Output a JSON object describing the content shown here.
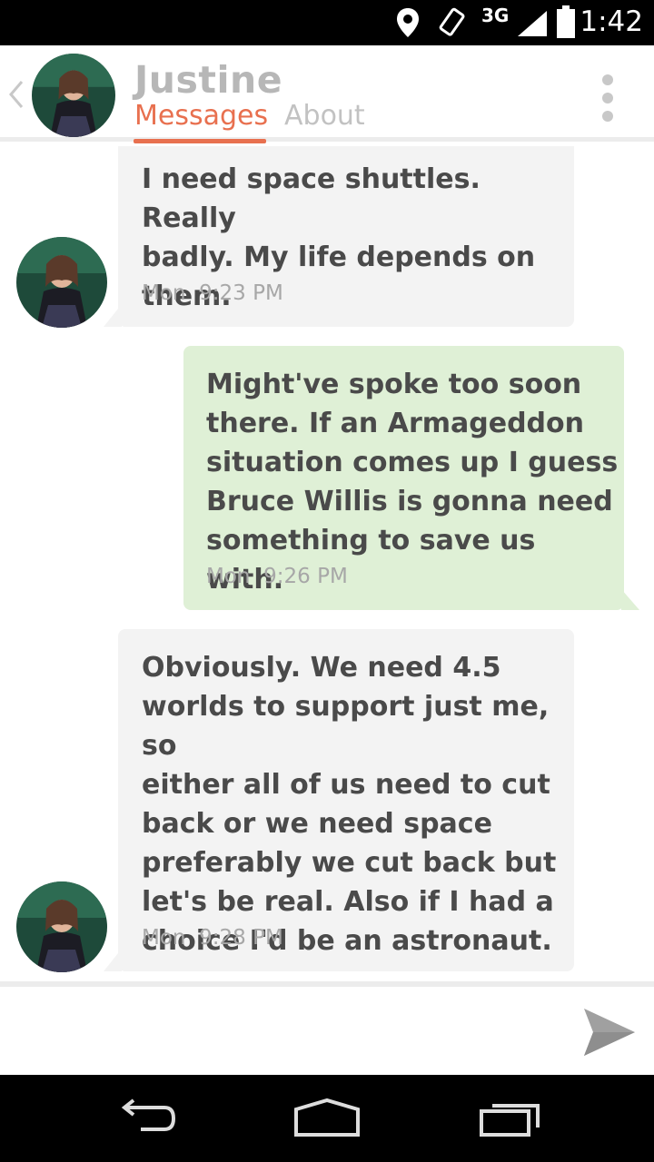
{
  "status_bar": {
    "network": "3G",
    "time": "1:42",
    "icons": [
      "location-icon",
      "rotate-icon",
      "signal-icon",
      "battery-icon"
    ]
  },
  "header": {
    "contact_name": "Justine",
    "tabs": [
      {
        "label": "Messages",
        "active": true
      },
      {
        "label": "About",
        "active": false
      }
    ],
    "accent_color": "#e8704f"
  },
  "messages": [
    {
      "direction": "incoming",
      "text": "I need space shuttles. Really\nbadly. My life depends on\nthem.",
      "time": "Mon  9:23 PM"
    },
    {
      "direction": "outgoing",
      "text": "Might've spoke too soon\nthere. If an Armageddon\nsituation comes up I guess\nBruce Willis is gonna need\nsomething to save us with.",
      "time": "Mon  9:26 PM"
    },
    {
      "direction": "incoming",
      "text": "Obviously. We need 4.5\nworlds to support just me, so\neither all of us need to cut\nback or we need space\npreferably we cut back but\nlet's be real. Also if I had a\nchoice I'd be an astronaut.",
      "time": "Mon  9:28 PM"
    }
  ],
  "composer": {
    "placeholder": "",
    "send_icon": "send-icon"
  },
  "nav_bar": {
    "buttons": [
      "back-icon",
      "home-icon",
      "recents-icon"
    ]
  }
}
